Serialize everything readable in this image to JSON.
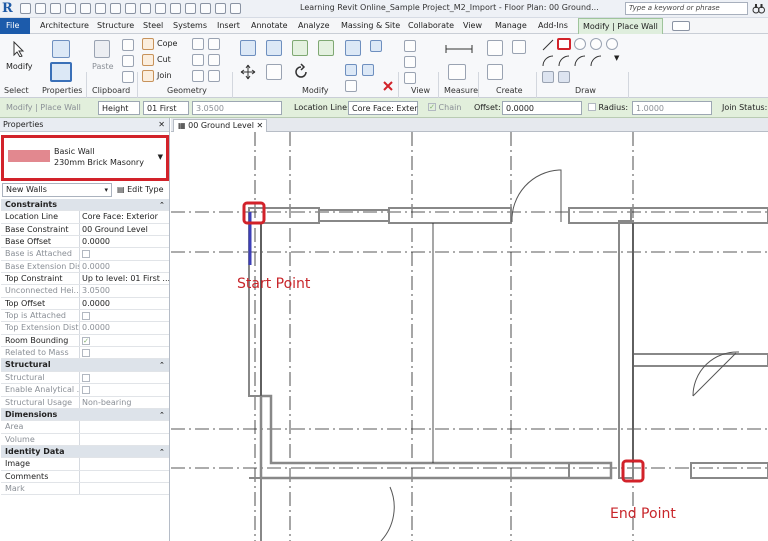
{
  "app": {
    "logo": "R",
    "title": "Learning Revit Online_Sample Project_M2_Import - Floor Plan: 00 Ground...",
    "search_placeholder": "Type a keyword or phrase"
  },
  "tabs": [
    "File",
    "Architecture",
    "Structure",
    "Steel",
    "Systems",
    "Insert",
    "Annotate",
    "Analyze",
    "Massing & Site",
    "Collaborate",
    "View",
    "Manage",
    "Add-Ins",
    "Modify | Place Wall"
  ],
  "ribbon": {
    "modify_label": "Modify",
    "paste_label": "Paste",
    "cope_label": "Cope",
    "cut_label": "Cut",
    "join_label": "Join",
    "panels": [
      "Select",
      "Properties",
      "Clipboard",
      "Geometry",
      "Modify",
      "View",
      "Measure",
      "Create",
      "Draw"
    ]
  },
  "options_bar": {
    "context": "Modify | Place Wall",
    "height_mode": "Height",
    "level": "01 First",
    "height_value": "3.0500",
    "location_line_label": "Location Line:",
    "location_line_value": "Core Face: Exter",
    "chain_label": "Chain",
    "offset_label": "Offset:",
    "offset_value": "0.0000",
    "radius_label": "Radius:",
    "radius_value": "1.0000",
    "join_status_label": "Join Status:"
  },
  "properties": {
    "title": "Properties",
    "type_family": "Basic Wall",
    "type_name": "230mm Brick Masonry",
    "instance_filter": "New Walls",
    "edit_type": "Edit Type",
    "sections": [
      {
        "name": "Constraints",
        "rows": [
          {
            "k": "Location Line",
            "v": "Core Face: Exterior",
            "dis": false
          },
          {
            "k": "Base Constraint",
            "v": "00 Ground Level",
            "dis": false
          },
          {
            "k": "Base Offset",
            "v": "0.0000",
            "dis": false
          },
          {
            "k": "Base is Attached",
            "v": "",
            "dis": true,
            "cb": true
          },
          {
            "k": "Base Extension Dis...",
            "v": "0.0000",
            "dis": true
          },
          {
            "k": "Top Constraint",
            "v": "Up to level: 01 First ...",
            "dis": false
          },
          {
            "k": "Unconnected Hei...",
            "v": "3.0500",
            "dis": true
          },
          {
            "k": "Top Offset",
            "v": "0.0000",
            "dis": false
          },
          {
            "k": "Top is Attached",
            "v": "",
            "dis": true,
            "cb": true
          },
          {
            "k": "Top Extension Dist...",
            "v": "0.0000",
            "dis": true
          },
          {
            "k": "Room Bounding",
            "v": "",
            "dis": false,
            "cb": true,
            "checked": true
          },
          {
            "k": "Related to Mass",
            "v": "",
            "dis": true,
            "cb": true
          }
        ]
      },
      {
        "name": "Structural",
        "rows": [
          {
            "k": "Structural",
            "v": "",
            "dis": true,
            "cb": true
          },
          {
            "k": "Enable Analytical ...",
            "v": "",
            "dis": true,
            "cb": true
          },
          {
            "k": "Structural Usage",
            "v": "Non-bearing",
            "dis": true
          }
        ]
      },
      {
        "name": "Dimensions",
        "rows": [
          {
            "k": "Area",
            "v": "",
            "dis": true
          },
          {
            "k": "Volume",
            "v": "",
            "dis": true
          }
        ]
      },
      {
        "name": "Identity Data",
        "rows": [
          {
            "k": "Image",
            "v": "",
            "dis": false
          },
          {
            "k": "Comments",
            "v": "",
            "dis": false
          },
          {
            "k": "Mark",
            "v": "",
            "dis": true
          }
        ]
      }
    ]
  },
  "view": {
    "tab_label": "00 Ground Level"
  },
  "annotations": {
    "start": "Start Point",
    "end": "End Point"
  },
  "colors": {
    "accent": "#1c5bab",
    "highlight": "#d2222a",
    "context_tab": "#dfeedd",
    "wall_swatch": "#e2888f"
  }
}
